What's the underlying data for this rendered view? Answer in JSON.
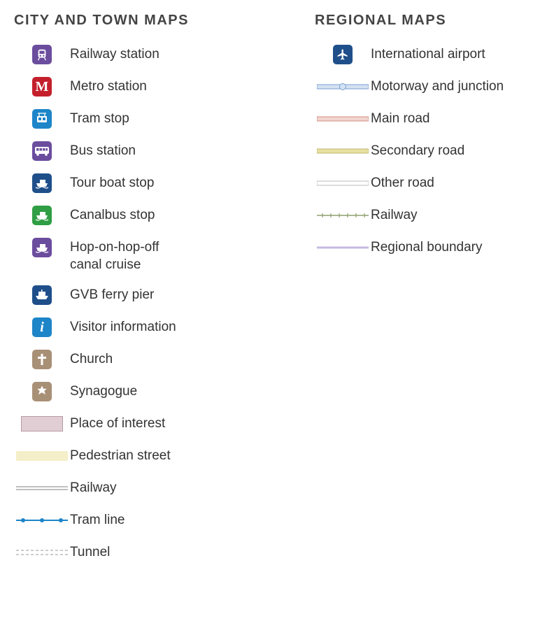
{
  "left": {
    "heading": "CITY AND TOWN MAPS",
    "items": [
      {
        "label": "Railway station"
      },
      {
        "label": "Metro station"
      },
      {
        "label": "Tram stop"
      },
      {
        "label": "Bus station"
      },
      {
        "label": "Tour boat stop"
      },
      {
        "label": "Canalbus stop"
      },
      {
        "label": "Hop-on-hop-off canal cruise"
      },
      {
        "label": "GVB ferry pier"
      },
      {
        "label": "Visitor information"
      },
      {
        "label": "Church"
      },
      {
        "label": "Synagogue"
      },
      {
        "label": "Place of interest"
      },
      {
        "label": "Pedestrian street"
      },
      {
        "label": "Railway"
      },
      {
        "label": "Tram line"
      },
      {
        "label": "Tunnel"
      }
    ]
  },
  "right": {
    "heading": "REGIONAL MAPS",
    "items": [
      {
        "label": "International airport"
      },
      {
        "label": "Motorway and junction"
      },
      {
        "label": "Main road"
      },
      {
        "label": "Secondary road"
      },
      {
        "label": "Other road"
      },
      {
        "label": "Railway"
      },
      {
        "label": "Regional boundary"
      }
    ]
  },
  "colors": {
    "purple": "#6b4d9e",
    "red": "#c4202c",
    "blue": "#1d85c8",
    "darkBlue": "#1f4f8a",
    "green": "#2f9e44",
    "tan": "#a89076",
    "poiFill": "#e0ced4",
    "pedFill": "#f5efc9",
    "railGrey": "#bfbfbf",
    "tramBlue": "#1d85c8",
    "motorwayBlue": "#a8c4e8",
    "mainRoad": "#e6b8b0",
    "secondaryRoad": "#d8d087",
    "otherRoad": "#cccccc",
    "regRailway": "#8da06f",
    "boundary": "#c6b8e0"
  }
}
